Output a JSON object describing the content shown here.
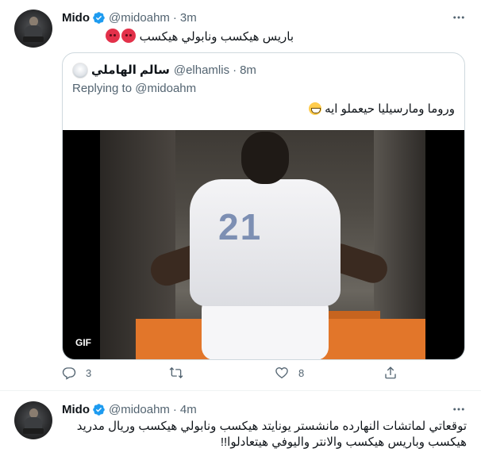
{
  "tweet1": {
    "author": {
      "name": "Mido",
      "handle": "@midoahm",
      "time": "3m"
    },
    "text": "باريس هيكسب ونابولي هيكسب",
    "text_emojis": [
      "angry-face",
      "angry-face"
    ],
    "quote": {
      "author_name": "سالم الهاملي",
      "author_handle": "@elhamlis",
      "time": "8m",
      "replying_label": "Replying to",
      "replying_handle": "@midoahm",
      "text": "وروما ومارسيليا حيعملو ايه",
      "text_emoji": "grinning-squinting-face",
      "media": {
        "type": "gif",
        "badge": "GIF",
        "jersey_number": "21"
      }
    },
    "actions": {
      "reply_count": "3",
      "retweet_count": "",
      "like_count": "8"
    }
  },
  "tweet2": {
    "author": {
      "name": "Mido",
      "handle": "@midoahm",
      "time": "4m"
    },
    "text": "توقعاتي لماتشات النهارده مانشستر يونايتد هيكسب ونابولي هيكسب وريال مدريد هيكسب وباريس هيكسب والانتر واليوفي هيتعادلوا!!"
  },
  "colors": {
    "verified": "#1d9bf0",
    "secondary_text": "#536471",
    "border": "#cfd9de",
    "gif_badge_bg": "#000000"
  }
}
